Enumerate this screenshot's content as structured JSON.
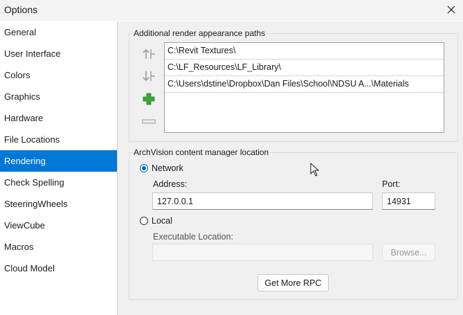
{
  "window": {
    "title": "Options"
  },
  "sidebar": {
    "items": [
      {
        "label": "General"
      },
      {
        "label": "User Interface"
      },
      {
        "label": "Colors"
      },
      {
        "label": "Graphics"
      },
      {
        "label": "Hardware"
      },
      {
        "label": "File Locations"
      },
      {
        "label": "Rendering",
        "selected": true
      },
      {
        "label": "Check Spelling"
      },
      {
        "label": "SteeringWheels"
      },
      {
        "label": "ViewCube"
      },
      {
        "label": "Macros"
      },
      {
        "label": "Cloud Model"
      }
    ]
  },
  "render_paths": {
    "title": "Additional render appearance paths",
    "paths": [
      "C:\\Revit Textures\\",
      "C:\\LF_Resources\\LF_Library\\",
      "C:\\Users\\dstine\\Dropbox\\Dan Files\\School\\NDSU A...\\Materials"
    ],
    "icons": {
      "up": "move-up-icon",
      "down": "move-down-icon",
      "add": "plus-icon",
      "remove": "minus-icon"
    },
    "colors": {
      "add": "#3fa535"
    }
  },
  "archvision": {
    "title": "ArchVision content manager location",
    "network_label": "Network",
    "network_selected": true,
    "address_label": "Address:",
    "address_value": "127.0.0.1",
    "port_label": "Port:",
    "port_value": "14931",
    "local_label": "Local",
    "executable_label": "Executable Location:",
    "executable_value": "",
    "browse_label": "Browse...",
    "get_more_label": "Get More RPC"
  },
  "colors": {
    "accent": "#0078d7"
  }
}
